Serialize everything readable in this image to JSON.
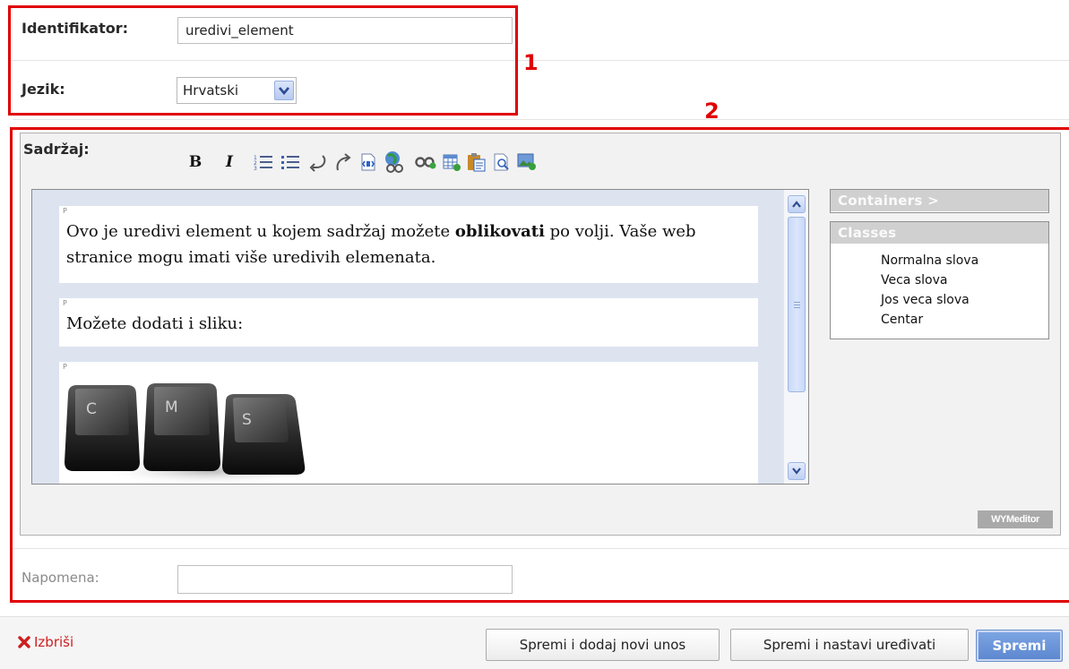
{
  "form": {
    "identifier": {
      "label": "Identifikator:",
      "value": "uredivi_element"
    },
    "language": {
      "label": "Jezik:",
      "selected": "Hrvatski"
    }
  },
  "annotations": {
    "box1_number": "1",
    "box2_number": "2"
  },
  "editor": {
    "label": "Sadržaj:",
    "toolbar": {
      "bold": "B",
      "italic": "I",
      "icons": [
        "ordered-list-icon",
        "unordered-list-icon",
        "undo-icon",
        "redo-icon",
        "html-source-icon",
        "link-icon",
        "unlink-icon",
        "insert-table-icon",
        "paste-icon",
        "preview-icon",
        "insert-image-icon"
      ]
    },
    "paragraph_marker": "P",
    "paragraphs": {
      "p1_before": "Ovo je uredivi element u kojem sadržaj možete ",
      "p1_bold": "oblikovati",
      "p1_after": " po volji. Vaše web stranice mogu imati više uredivih elemenata.",
      "p2": "Možete dodati i sliku:"
    },
    "image_keys": [
      "C",
      "M",
      "S"
    ],
    "containers_label": "Containers >",
    "classes_label": "Classes",
    "classes": [
      "Normalna slova",
      "Veca slova",
      "Jos veca slova",
      "Centar"
    ],
    "brand": "WYMeditor"
  },
  "note": {
    "label": "Napomena:",
    "value": ""
  },
  "footer": {
    "delete_label": "Izbriši",
    "save_add_label": "Spremi i dodaj novi unos",
    "save_continue_label": "Spremi i nastavi uređivati",
    "save_label": "Spremi"
  },
  "colors": {
    "annotation_red": "#e00000",
    "primary_button": "#6a94d9",
    "delete_red": "#cc1f1f"
  }
}
